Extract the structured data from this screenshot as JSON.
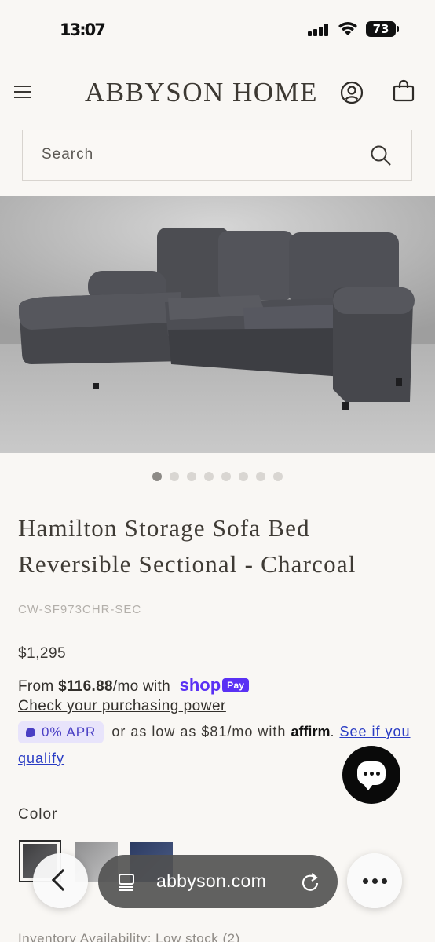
{
  "status_bar": {
    "time": "13:07",
    "battery": "73"
  },
  "header": {
    "brand": "ABBYSON HOME"
  },
  "search": {
    "placeholder": "Search"
  },
  "carousel": {
    "total": 8,
    "active_index": 0
  },
  "product": {
    "title": "Hamilton Storage Sofa Bed Reversible Sectional - Charcoal",
    "sku": "CW-SF973CHR-SEC",
    "price": "$1,295"
  },
  "shop_pay": {
    "from": "From",
    "amount": "$116.88",
    "per": "/mo with",
    "shop": "shop",
    "pay": "Pay",
    "purchasing_link": "Check your purchasing power"
  },
  "affirm": {
    "apr": "0% APR",
    "text": "or as low as $81/mo with",
    "logo": "affirm",
    "link": "See if you qualify"
  },
  "color": {
    "label": "Color",
    "swatches": [
      "Charcoal",
      "Grey",
      "Navy"
    ],
    "colors": [
      "#4a4a4c",
      "#a9a9aa",
      "#3b4b74"
    ]
  },
  "inventory": {
    "text": "Inventory Availability:  Low stock (2)"
  },
  "browser": {
    "url": "abbyson.com"
  }
}
